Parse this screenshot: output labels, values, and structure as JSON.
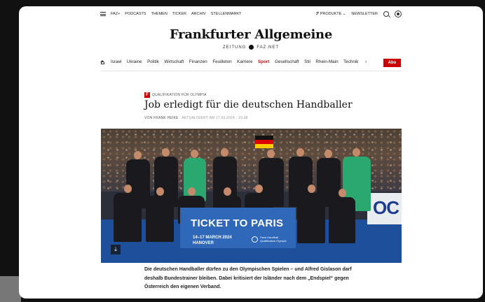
{
  "topbar": {
    "left_links": [
      "FAZ+",
      "PODCASTS",
      "THEMEN",
      "TICKER",
      "ARCHIV",
      "STELLENMARKT"
    ],
    "produkte_label": "PRODUKTE",
    "newsletter_label": "NEWSLETTER"
  },
  "logo": {
    "title": "Frankfurter Allgemeine",
    "sub_left": "ZEITUNG",
    "sub_right": "FAZ.NET"
  },
  "nav": {
    "items": [
      "Israel",
      "Ukraine",
      "Politik",
      "Wirtschaft",
      "Finanzen",
      "Feuilleton",
      "Karriere",
      "Sport",
      "Gesellschaft",
      "Stil",
      "Rhein-Main",
      "Technik"
    ],
    "active": "Sport",
    "chevron": "›",
    "abo_label": "Abo"
  },
  "article": {
    "plus_badge": "F",
    "kicker": "QUALIFIKATION FÜR OLYMPIA",
    "headline": "Job erledigt für die deutschen Handballer",
    "byline_author": "VON FRANK HEIKE",
    "byline_updated": "· AKTUALISIERT AM 17.03.2024 · 15:38",
    "teaser": "Die deutschen Handballer dürfen zu den Olympischen Spielen – und Alfred Gislason darf deshalb Bundestrainer bleiben. Dabei kritisiert der Isländer nach dem „Endspiel“ gegen Österreich den eigenen Verband."
  },
  "image": {
    "banner_title": "TICKET TO PARIS",
    "banner_date": "14–17 MARCH 2024",
    "banner_city": "HANOVER",
    "banner_logo_line1": "Paris Handball",
    "banner_logo_line2": "Qualification Olympic",
    "adboard_text": "OC",
    "corner_icon": "⤓"
  },
  "colors": {
    "accent": "#cc0000",
    "banner": "#2f67b9",
    "court": "#1d4f9a"
  }
}
